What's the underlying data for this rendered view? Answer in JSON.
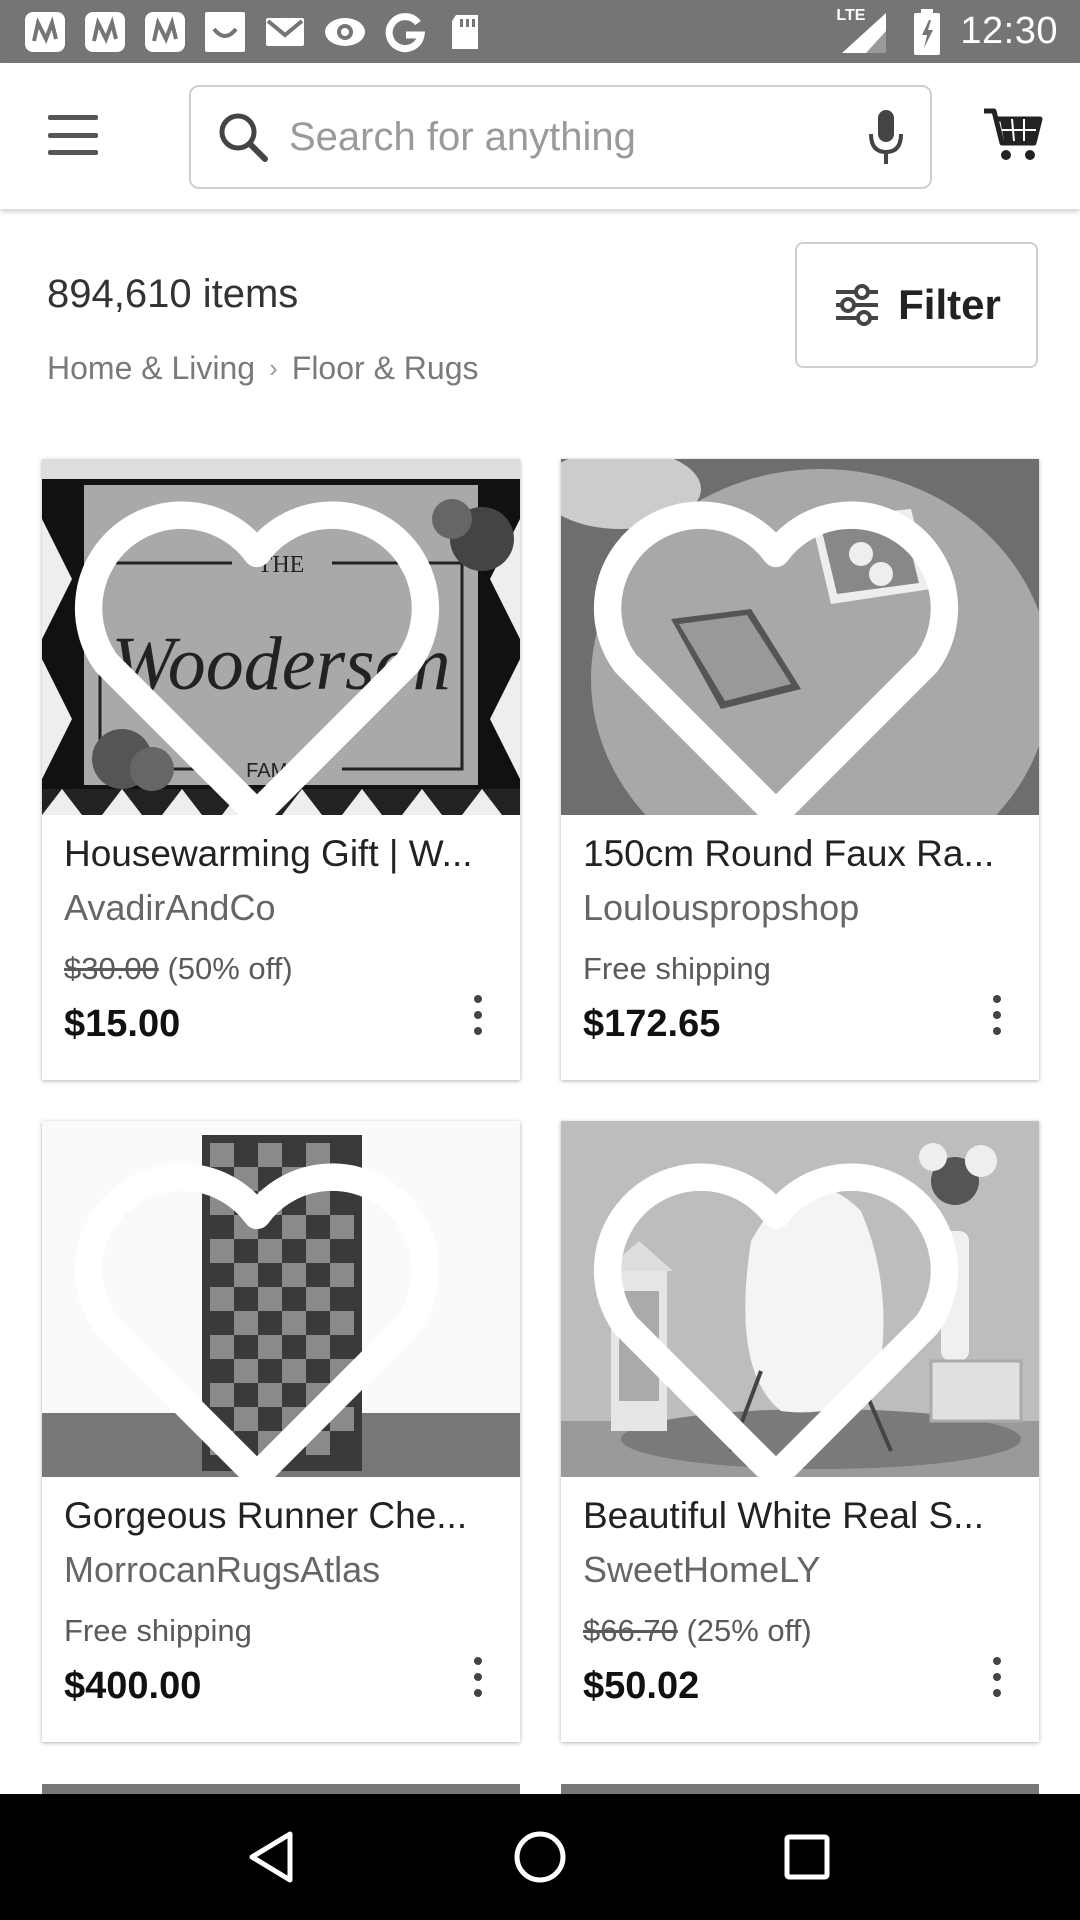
{
  "status_bar": {
    "time": "12:30",
    "network": "LTE",
    "notification_icons": [
      "app-n-icon",
      "app-n-icon",
      "app-n-icon",
      "smile-icon",
      "gmail-icon",
      "eye-icon",
      "google-icon",
      "sd-card-icon"
    ]
  },
  "search": {
    "placeholder": "Search for anything",
    "value": ""
  },
  "results": {
    "count_text": "894,610 items",
    "breadcrumb": [
      "Home & Living",
      "Floor & Rugs"
    ],
    "filter_label": "Filter"
  },
  "listings": [
    {
      "title": "Housewarming Gift | W...",
      "shop": "AvadirAndCo",
      "original_price": "$30.00",
      "discount": "(50% off)",
      "shipping": "",
      "price": "$15.00",
      "image_text": [
        "THE",
        "Wooderson",
        "FAMILY"
      ]
    },
    {
      "title": "150cm Round Faux Ra...",
      "shop": "Loulouspropshop",
      "original_price": "",
      "discount": "",
      "shipping": "Free shipping",
      "price": "$172.65"
    },
    {
      "title": "Gorgeous Runner Che...",
      "shop": "MorrocanRugsAtlas",
      "original_price": "",
      "discount": "",
      "shipping": "Free shipping",
      "price": "$400.00"
    },
    {
      "title": "Beautiful White Real S...",
      "shop": "SweetHomeLY",
      "original_price": "$66.70",
      "discount": "(25% off)",
      "shipping": "",
      "price": "$50.02"
    }
  ]
}
